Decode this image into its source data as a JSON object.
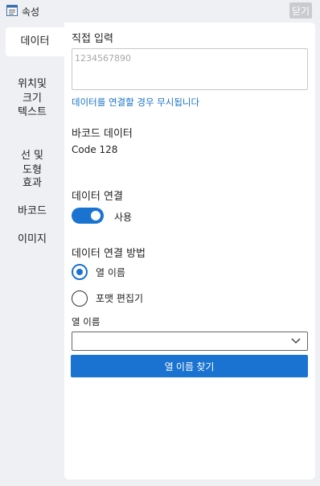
{
  "window": {
    "title": "속성",
    "close_label": "닫기"
  },
  "sidebar": {
    "items": [
      {
        "label": "데이터"
      },
      {
        "label": "위치및\n크기"
      },
      {
        "label": "텍스트"
      },
      {
        "label": "선 및\n도형"
      },
      {
        "label": "효과"
      },
      {
        "label": "바코드"
      },
      {
        "label": "이미지"
      }
    ]
  },
  "panel": {
    "direct_input": {
      "heading": "직접 입력",
      "placeholder": "1234567890",
      "note": "데이터를 연결할 경우 무시됩니다"
    },
    "barcode_data": {
      "heading": "바코드 데이터",
      "value": "Code 128"
    },
    "data_link": {
      "heading": "데이터 연결",
      "toggle_label": "사용",
      "toggle_on": true
    },
    "link_method": {
      "heading": "데이터 연결 방법",
      "options": [
        {
          "label": "열 이름",
          "checked": true
        },
        {
          "label": "포맷 편집기",
          "checked": false
        }
      ]
    },
    "column": {
      "label": "열 이름",
      "selected_value": "",
      "find_button_label": "열 이름 찾기"
    }
  },
  "colors": {
    "accent": "#1a73d1",
    "link": "#1a73c8",
    "close_bg": "#c9cbcf"
  }
}
